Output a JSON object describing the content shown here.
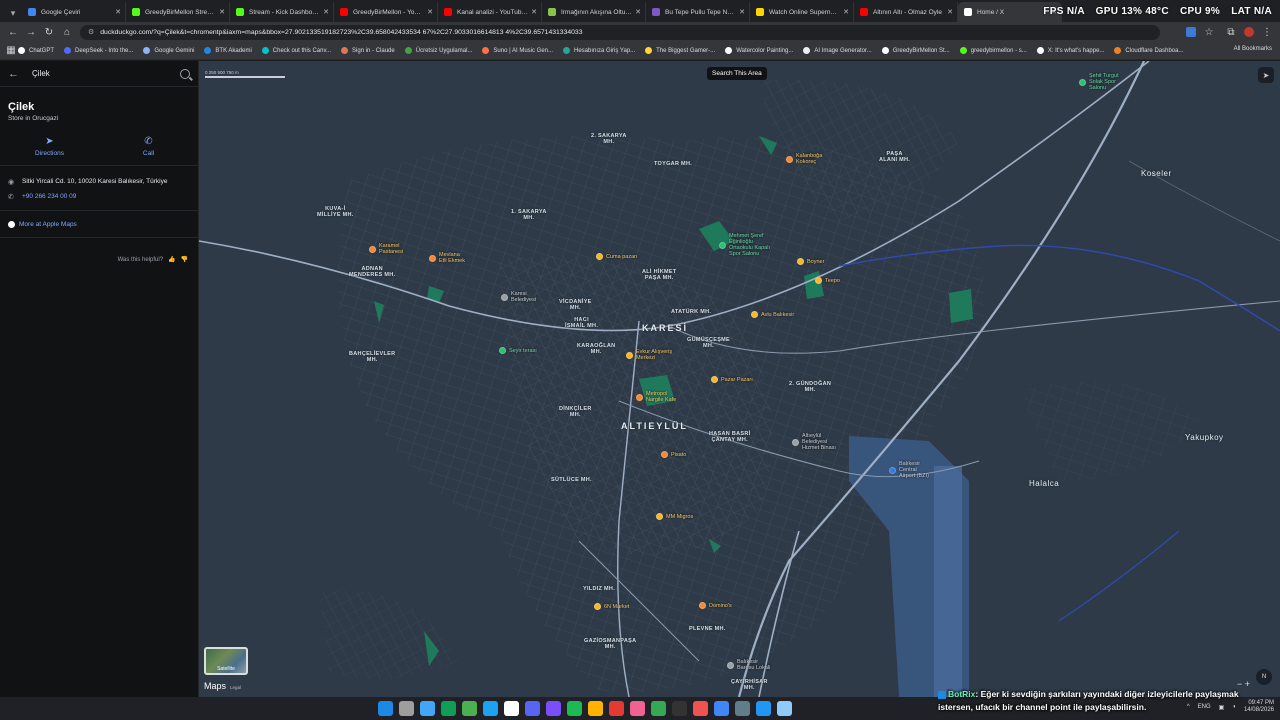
{
  "browser": {
    "tabs": [
      {
        "label": "Google Çeviri",
        "color": "#4285f4"
      },
      {
        "label": "GreedyBirMellon Stream",
        "color": "#53fc18"
      },
      {
        "label": "Stream - Kick Dashboard",
        "color": "#53fc18"
      },
      {
        "label": "GreedyBirMellon - YouTube",
        "color": "#ff0000"
      },
      {
        "label": "Kanal analizi - YouTube Studio",
        "color": "#ff0000"
      },
      {
        "label": "Irmağının Akışına Olturan",
        "color": "#8bc34a"
      },
      {
        "label": "Bu Tepe Pullu Tepe Notalar",
        "color": "#7e57c2"
      },
      {
        "label": "Watch Online Supernatural",
        "color": "#ffd600"
      },
      {
        "label": "Altının Altı - Olmaz Öyle",
        "color": "#ff0000"
      },
      {
        "label": "Home / X",
        "color": "#ffffff"
      }
    ],
    "url": "duckduckgo.com/?q=Çilek&t=chromentp&iaxm=maps&bbox=27.902133519182723%2C39.658042433534 67%2C27.9033016614813 4%2C39.6571431334033",
    "overlay": {
      "fps": "FPS N/A",
      "gpu": "GPU 13% 48°C",
      "cpu": "CPU 9%",
      "lat": "LAT N/A"
    },
    "bookmarks": [
      {
        "label": "ChatGPT",
        "color": "#ffffff"
      },
      {
        "label": "DeepSeek - Into the...",
        "color": "#4d6bfe"
      },
      {
        "label": "Google Gemini",
        "color": "#8ab4f8"
      },
      {
        "label": "BTK Akademi",
        "color": "#1e88e5"
      },
      {
        "label": "Check out this Canv...",
        "color": "#00c4cc"
      },
      {
        "label": "Sign in - Claude",
        "color": "#d97757"
      },
      {
        "label": "Ücretsiz Uygulamal...",
        "color": "#43a047"
      },
      {
        "label": "Suno | AI Music Gen...",
        "color": "#ff7043"
      },
      {
        "label": "Hesabınıza Giriş Yap...",
        "color": "#26a69a"
      },
      {
        "label": "The Biggest Gamer-...",
        "color": "#fdd835"
      },
      {
        "label": "Watercolor Painting...",
        "color": "#ffffff"
      },
      {
        "label": "AI Image Generator...",
        "color": "#eeeeee"
      },
      {
        "label": "GreedyBirMellon St...",
        "color": "#ffffff"
      },
      {
        "label": "greedybirmellon - s...",
        "color": "#53fc18"
      },
      {
        "label": "X: It's what's happe...",
        "color": "#ffffff"
      },
      {
        "label": "Cloudflare Dashboa...",
        "color": "#f38020"
      }
    ],
    "all_bookmarks": "All Bookmarks"
  },
  "sidebar": {
    "query": "Çilek",
    "title": "Çilek",
    "subtitle": "Store in Orucgazi",
    "directions": "Directions",
    "call": "Call",
    "address": "Sitki Yircali Cd. 10, 10020 Karesi Balıkesir, Türkiye",
    "phone": "+90 266 234 00 09",
    "more": "More at Apple Maps",
    "helpful": "Was this helpful?"
  },
  "map": {
    "search_area": "Search This Area",
    "scale": [
      "0",
      "250",
      "500",
      "750 m"
    ],
    "satellite": "Satellite",
    "logo": "Maps",
    "legal": "Legal",
    "compass": "N",
    "districts": [
      {
        "t": "2. SAKARYA\nMH."
      },
      {
        "t": "TOYGAR MH."
      },
      {
        "t": "PAŞA\nALANI MH."
      },
      {
        "t": "KUVA-İ\nMİLLİYE MH."
      },
      {
        "t": "1. SAKARYA\nMH."
      },
      {
        "t": "VİCDANİYE\nMH."
      },
      {
        "t": "ALİ HİKMET\nPAŞA MH."
      },
      {
        "t": "ADNAN\nMENDERES MH."
      },
      {
        "t": "HACI\nİSMAİL MH."
      },
      {
        "t": "ATATÜRK MH."
      },
      {
        "t": "KARAOĞLAN\nMH."
      },
      {
        "t": "GÜMÜŞÇEŞME\nMH."
      },
      {
        "t": "2. GÜNDOĞAN\nMH."
      },
      {
        "t": "DİNKÇİLER\nMH."
      },
      {
        "t": "HASAN BASRİ\nÇANTAY MH."
      },
      {
        "t": "SÜTLÜCE MH."
      },
      {
        "t": "YILDIZ MH."
      },
      {
        "t": "PLEVNE MH."
      },
      {
        "t": "GAZİOSMANPAŞA\nMH."
      },
      {
        "t": "ÇAYIRHİSAR\nMH."
      },
      {
        "t": "BAHÇELİEVLER\nMH."
      }
    ],
    "big_labels": [
      "KARESİ",
      "ALTIEYLÜL"
    ],
    "towns": [
      "Koseler",
      "Yakupkoy",
      "Halalca"
    ],
    "pois": [
      {
        "t": "Kalanboğa\nKokoreç",
        "c": "#f08a3a"
      },
      {
        "t": "Mehmet Şeref\nEğinlioğlu\nOrtaokulu Kapalı\nSpor Salonu",
        "c": "#2fbf71"
      },
      {
        "t": "Boyner",
        "c": "#f5b731"
      },
      {
        "t": "Teepo",
        "c": "#f5b731"
      },
      {
        "t": "Avlu Balıkesir",
        "c": "#f5b731"
      },
      {
        "t": "Karamel\nPastanesi",
        "c": "#f08a3a"
      },
      {
        "t": "Mevlana\nEtli Ekmek",
        "c": "#f08a3a"
      },
      {
        "t": "Cuma pazarı",
        "c": "#f5b731"
      },
      {
        "t": "Karesi\nBelediyesi",
        "c": "#9aa0a6"
      },
      {
        "t": "Seyir terası",
        "c": "#2fbf71"
      },
      {
        "t": "Evkur Alışveriş\nMerkezi",
        "c": "#f5b731"
      },
      {
        "t": "Pazar Pazarı",
        "c": "#f5b731"
      },
      {
        "t": "Metropol\nNargile Kafe",
        "c": "#f08a3a"
      },
      {
        "t": "Altıeylül\nBelediyesi\nHizmet Binası",
        "c": "#9aa0a6"
      },
      {
        "t": "Pisato",
        "c": "#f08a3a"
      },
      {
        "t": "Balıkesir\nCentral\nAirport (BZI)",
        "c": "#3a7bd5"
      },
      {
        "t": "MM Migros",
        "c": "#f5b731"
      },
      {
        "t": "6N Market",
        "c": "#f5b731"
      },
      {
        "t": "Domino's",
        "c": "#f08a3a"
      },
      {
        "t": "Balıkesir\nBarosu Lokali",
        "c": "#9aa0a6"
      },
      {
        "t": "Şehit Turgut\nSolak Spor\nSalonu",
        "c": "#2fbf71"
      }
    ]
  },
  "taskbar": {
    "icons": [
      "#1e88e5",
      "#9e9e9e",
      "#42a5f5",
      "#0f9d58",
      "#4caf50",
      "#1da1f2",
      "#ffffff",
      "#5865f2",
      "#7c4dff",
      "#1db954",
      "#ffb300",
      "#e53935",
      "#f06292",
      "#34a853",
      "#333333",
      "#ef5350",
      "#4285f4",
      "#607d8b",
      "#2196f3",
      "#90caf9"
    ],
    "lang": "ENG",
    "time": "09:47 PM",
    "date": "14/08/2026"
  },
  "chat": {
    "user": "BotRix",
    "message": ": Eğer ki sevdiğin şarkıları yayındaki diğer izleyicilerle paylaşmak istersen, ufacık bir channel point ile paylaşabilirsin."
  }
}
